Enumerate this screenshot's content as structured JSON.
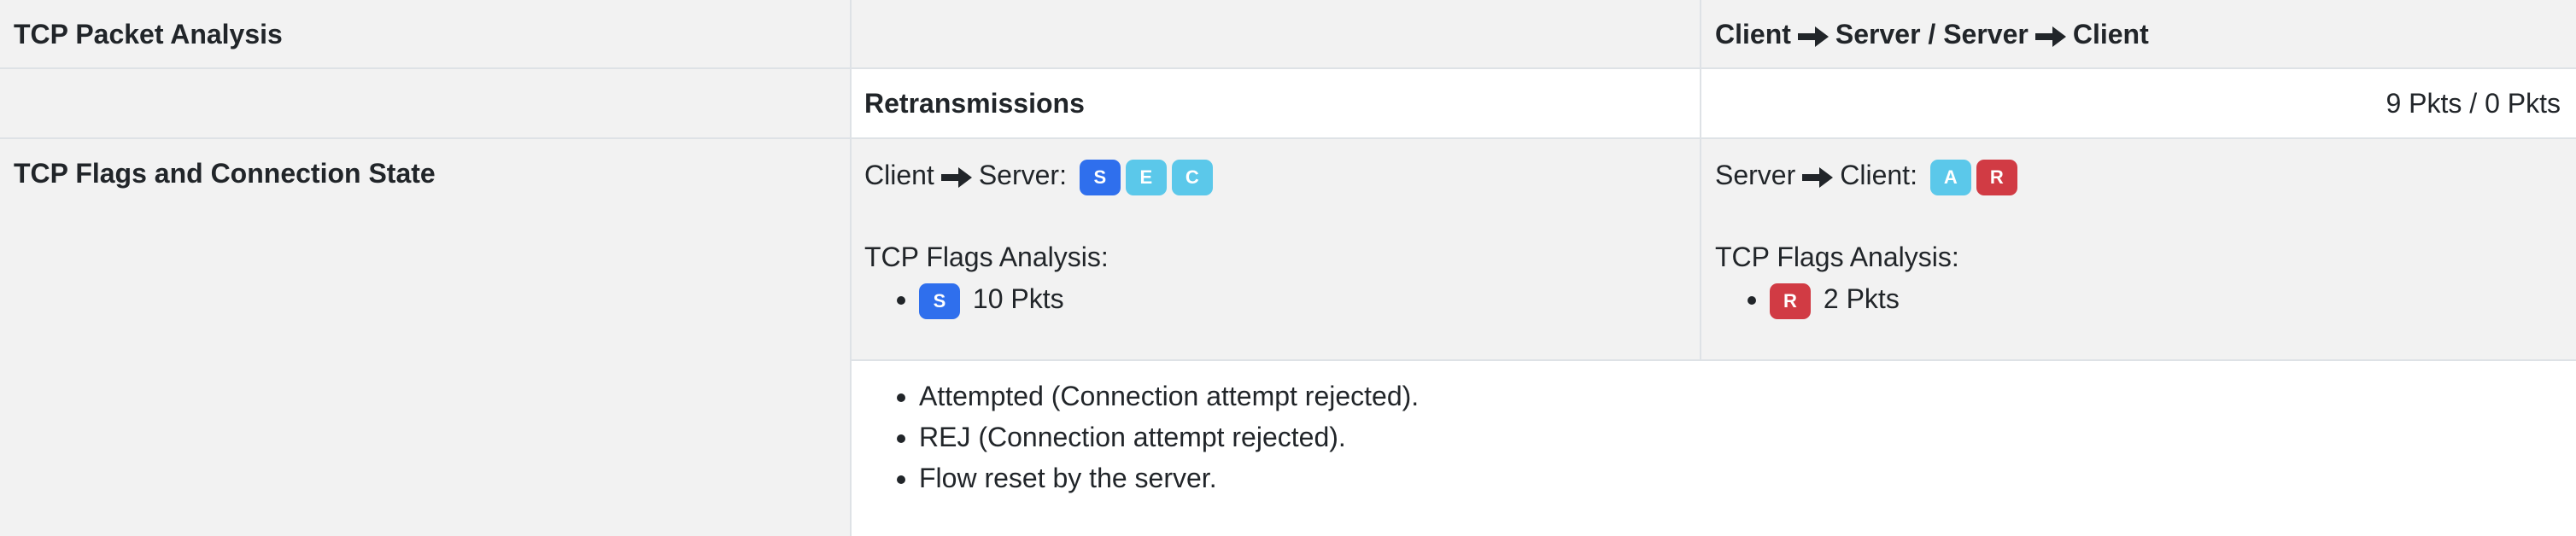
{
  "analysis": {
    "title": "TCP Packet Analysis",
    "direction_header": {
      "client": "Client",
      "server_mid": "Server / Server",
      "client_end": "Client"
    },
    "retransmissions": {
      "label": "Retransmissions",
      "value": "9 Pkts / 0 Pkts"
    }
  },
  "flags": {
    "label": "TCP Flags and Connection State",
    "client_to_server": {
      "from": "Client",
      "to": "Server:",
      "badges": [
        {
          "letter": "S",
          "color": "#2f6fed"
        },
        {
          "letter": "E",
          "color": "#5bc8ea"
        },
        {
          "letter": "C",
          "color": "#5bc8ea"
        }
      ],
      "analysis_label": "TCP Flags Analysis:",
      "items": [
        {
          "letter": "S",
          "color": "#2f6fed",
          "count": "10 Pkts"
        }
      ]
    },
    "server_to_client": {
      "from": "Server",
      "to": "Client:",
      "badges": [
        {
          "letter": "A",
          "color": "#5bc8ea"
        },
        {
          "letter": "R",
          "color": "#d13b44"
        }
      ],
      "analysis_label": "TCP Flags Analysis:",
      "items": [
        {
          "letter": "R",
          "color": "#d13b44",
          "count": "2 Pkts"
        }
      ]
    },
    "notes": [
      "Attempted (Connection attempt rejected).",
      "REJ (Connection attempt rejected).",
      "Flow reset by the server."
    ]
  },
  "icons": {
    "arrow": "right-arrow-icon"
  },
  "colors": {
    "flag_blue": "#2f6fed",
    "flag_cyan": "#5bc8ea",
    "flag_red": "#d13b44",
    "row_gray": "#f2f2f2",
    "border": "#dee2e6"
  }
}
